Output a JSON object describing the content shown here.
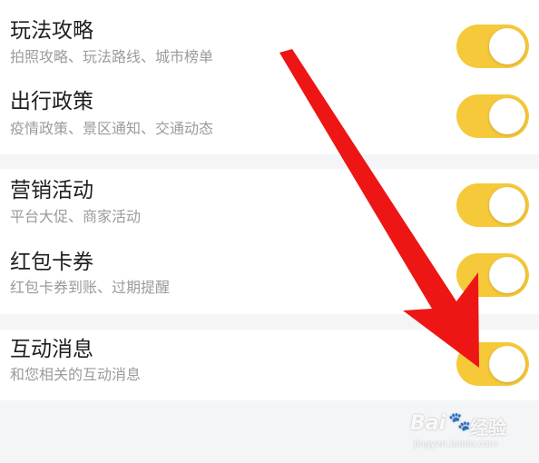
{
  "settings": {
    "items": [
      {
        "title": "玩法攻略",
        "subtitle": "拍照攻略、玩法路线、城市榜单",
        "enabled": true
      },
      {
        "title": "出行政策",
        "subtitle": "疫情政策、景区通知、交通动态",
        "enabled": true
      },
      {
        "title": "营销活动",
        "subtitle": "平台大促、商家活动",
        "enabled": true
      },
      {
        "title": "红包卡券",
        "subtitle": "红包卡券到账、过期提醒",
        "enabled": true
      },
      {
        "title": "互动消息",
        "subtitle": "和您相关的互动消息",
        "enabled": true
      }
    ]
  },
  "annotation": {
    "arrow_color": "#ee1515",
    "points_to": "互动消息 toggle"
  },
  "watermark": {
    "brand": "Bai",
    "brand_suffix": "经验",
    "url": "jingyan.baidu.com"
  },
  "colors": {
    "toggle_on": "#f5c93a",
    "background": "#f4f5f7",
    "card": "#ffffff"
  }
}
